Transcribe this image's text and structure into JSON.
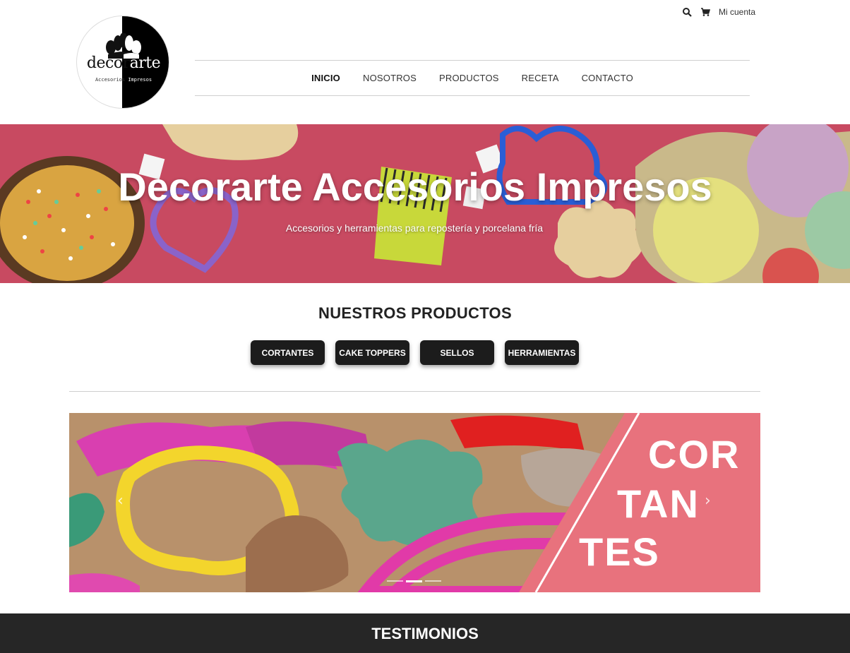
{
  "logo": {
    "word_dark": "decor",
    "word_light": "arte",
    "tagline_dark": "Accesorios ",
    "tagline_light": "Impresos"
  },
  "topbar": {
    "search_icon": "search-icon",
    "cart_icon": "cart-icon",
    "account_label": "Mi cuenta"
  },
  "nav": {
    "items": [
      {
        "label": "INICIO",
        "active": true
      },
      {
        "label": "NOSOTROS",
        "active": false
      },
      {
        "label": "PRODUCTOS",
        "active": false
      },
      {
        "label": "RECETA",
        "active": false
      },
      {
        "label": "CONTACTO",
        "active": false
      }
    ]
  },
  "hero": {
    "title": "Decorarte Accesorios Impresos",
    "subtitle": "Accesorios y herramientas para repostería y porcelana fría"
  },
  "products": {
    "title": "NUESTROS PRODUCTOS",
    "buttons": [
      "CORTANTES",
      "CAKE TOPPERS",
      "SELLOS",
      "HERRAMIENTAS"
    ]
  },
  "carousel": {
    "word_line1": "COR",
    "word_line2": "TAN",
    "word_line3": "TES",
    "prev_icon": "chevron-left-icon",
    "next_icon": "chevron-right-icon",
    "slides_total": 3,
    "active_slide": 2
  },
  "testimonios": {
    "title": "TESTIMONIOS"
  },
  "colors": {
    "hero_bg": "#c94a62",
    "button_bg": "#1c1c1c",
    "panel_pink": "#e8727d",
    "footer_bg": "#262626"
  }
}
